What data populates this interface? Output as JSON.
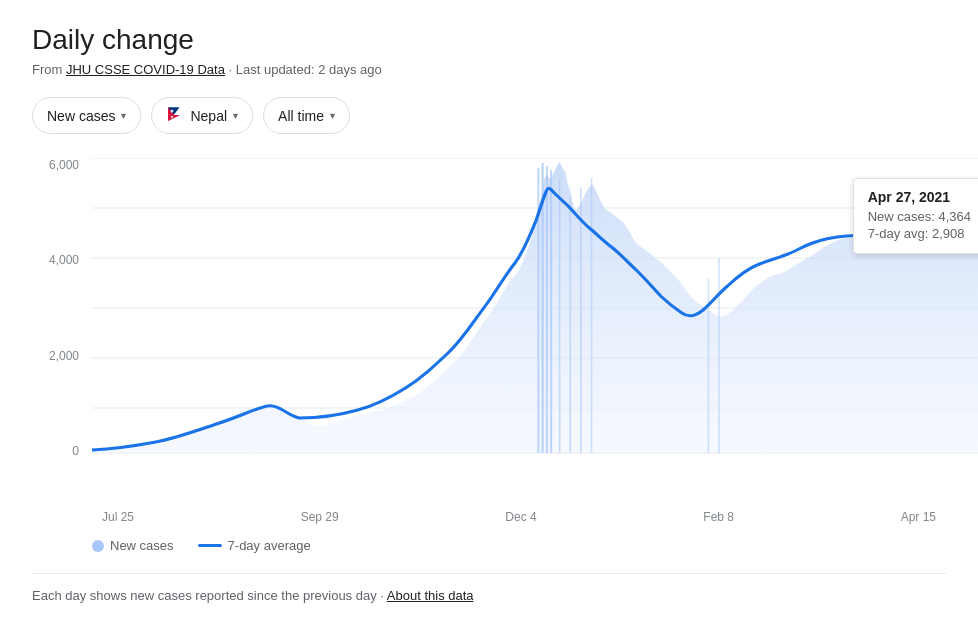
{
  "header": {
    "title": "Daily change",
    "source_label": "From ",
    "source_link": "JHU CSSE COVID-19 Data",
    "updated": "Last updated: 2 days ago"
  },
  "filters": {
    "metric": "New cases",
    "country": "Nepal",
    "timerange": "All time"
  },
  "yaxis": {
    "labels": [
      "6,000",
      "4,000",
      "2,000",
      "0"
    ]
  },
  "xaxis": {
    "labels": [
      "Jul 25",
      "Sep 29",
      "Dec 4",
      "Feb 8",
      "Apr 15"
    ]
  },
  "tooltip": {
    "date": "Apr 27, 2021",
    "new_cases_label": "New cases:",
    "new_cases_value": "4,364",
    "avg_label": "7-day avg:",
    "avg_value": "2,908"
  },
  "legend": {
    "dot_label": "New cases",
    "line_label": "7-day average"
  },
  "footer": {
    "text": "Each day shows new cases reported since the previous day  ·  ",
    "link": "About this data"
  },
  "colors": {
    "area_fill": "#c6d9f7",
    "area_stroke": "#a8c7fa",
    "line": "#1a73e8",
    "tooltip_border": "#e0e0e0"
  }
}
